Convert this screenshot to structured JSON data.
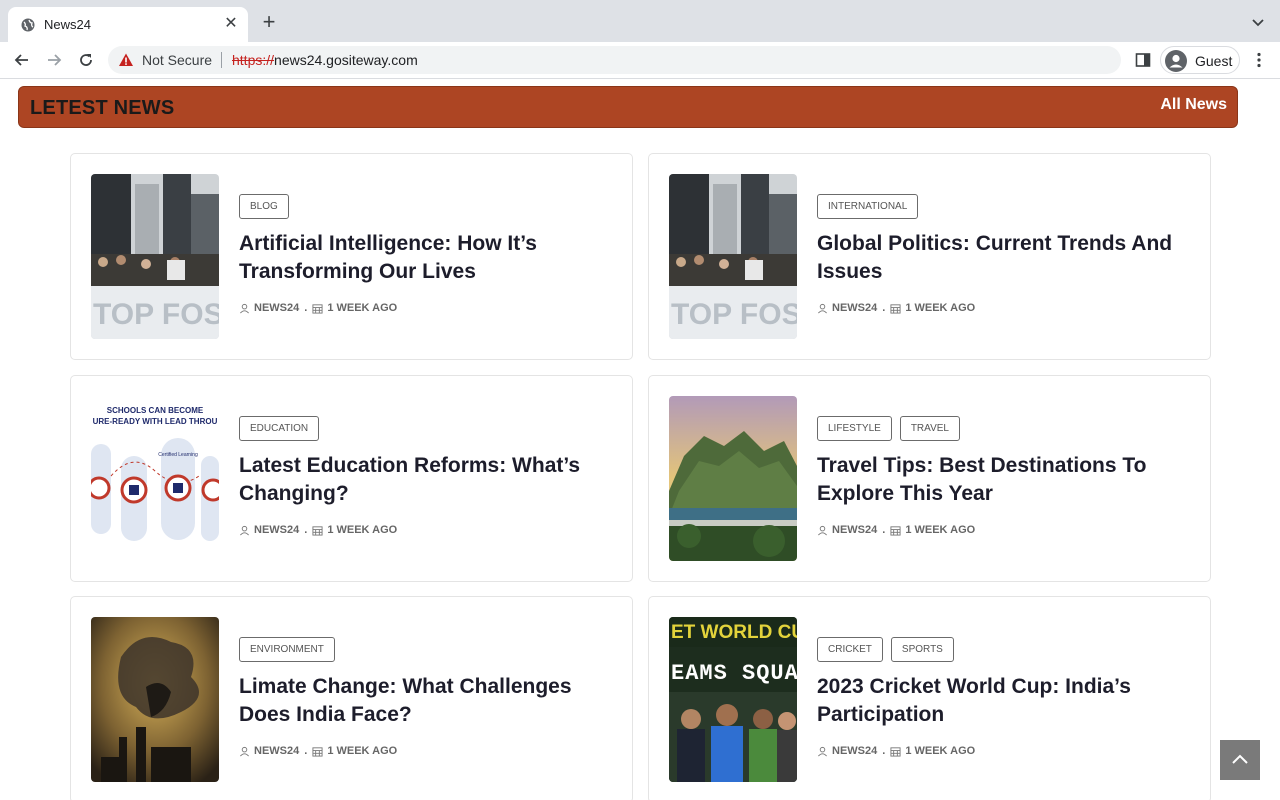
{
  "browser": {
    "tab_title": "News24",
    "security_label": "Not Secure",
    "url_scheme": "https://",
    "url_host": "news24.gositeway.com",
    "profile_name": "Guest"
  },
  "banner": {
    "title": "LETEST NEWS",
    "link": "All News"
  },
  "cards": [
    {
      "tags": [
        "BLOG"
      ],
      "title": "Artificial Intelligence: How It’s Transforming Our Lives",
      "author": "NEWS24",
      "time": "1 WEEK AGO"
    },
    {
      "tags": [
        "INTERNATIONAL"
      ],
      "title": "Global Politics: Current Trends And Issues",
      "author": "NEWS24",
      "time": "1 WEEK AGO"
    },
    {
      "tags": [
        "EDUCATION"
      ],
      "title": "Latest Education Reforms: What’s Changing?",
      "author": "NEWS24",
      "time": "1 WEEK AGO",
      "image_text": [
        "SCHOOLS CAN BECOME",
        "URE-READY WITH LEAD THROU",
        "Certified Learning"
      ]
    },
    {
      "tags": [
        "LIFESTYLE",
        "TRAVEL"
      ],
      "title": "Travel Tips: Best Destinations To Explore This Year",
      "author": "NEWS24",
      "time": "1 WEEK AGO"
    },
    {
      "tags": [
        "ENVIRONMENT"
      ],
      "title": "Limate Change: What Challenges Does India Face?",
      "author": "NEWS24",
      "time": "1 WEEK AGO"
    },
    {
      "tags": [
        "CRICKET",
        "SPORTS"
      ],
      "title": "2023 Cricket World Cup: India’s Participation",
      "author": "NEWS24",
      "time": "1 WEEK AGO",
      "image_text": [
        "ET WORLD CUP",
        "EAMS SQUA"
      ]
    }
  ],
  "colors": {
    "banner": "#ad4523",
    "title": "#1d1d2b",
    "back_to_top": "#7a7a7a"
  }
}
